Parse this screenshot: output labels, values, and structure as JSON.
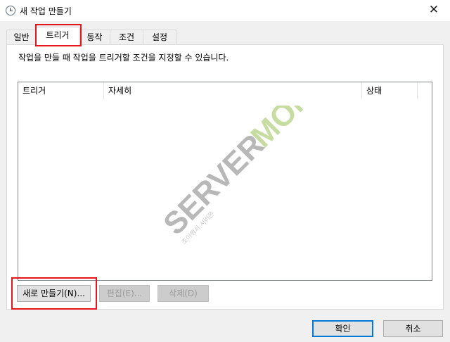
{
  "window": {
    "title": "새 작업 만들기",
    "close_glyph": "✕"
  },
  "tabs": [
    {
      "label": "일반"
    },
    {
      "label": "트리거"
    },
    {
      "label": "동작"
    },
    {
      "label": "조건"
    },
    {
      "label": "설정"
    }
  ],
  "triggers_page": {
    "description": "작업을 만들 때 작업을 트리거할 조건을 지정할 수 있습니다.",
    "columns": [
      "트리거",
      "자세히",
      "상태"
    ],
    "rows": [],
    "new_button": "새로 만들기(N)...",
    "edit_button": "편집(E)...",
    "delete_button": "삭제(D)"
  },
  "footer": {
    "ok": "확인",
    "cancel": "취소"
  },
  "watermark": {
    "brand_a": "SERVER",
    "brand_b": "MON",
    "small": "조이행서 서버몬"
  },
  "colors": {
    "highlight": "#e8141c",
    "default_button_border": "#0078d7"
  }
}
